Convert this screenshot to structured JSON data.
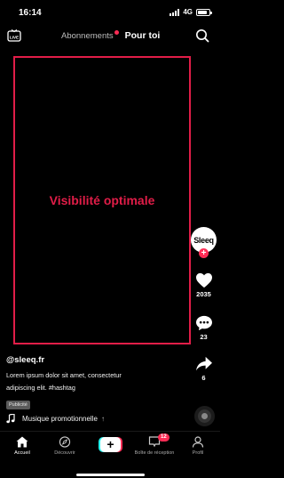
{
  "status_bar": {
    "time": "16:14",
    "network": "4G",
    "battery_level": 0.8
  },
  "top_bar": {
    "live_label": "LIVE",
    "tab_following": "Abonnements",
    "tab_for_you": "Pour toi"
  },
  "overlay": {
    "safe_zone_label": "Visibilité optimale",
    "color": "#e11d48"
  },
  "side_actions": {
    "avatar_text": "Sleeq",
    "likes": "2035",
    "comments": "23",
    "shares": "6"
  },
  "post": {
    "username": "@sleeq.fr",
    "caption_line1": "Lorem ipsum dolor sit amet, consectetur",
    "caption_line2": "adipiscing elit. #hashtag",
    "ad_badge": "Publicité",
    "music": "Musique promotionnelle"
  },
  "bottom_nav": {
    "home": "Accueil",
    "discover": "Découvrir",
    "inbox": "Boîte de réception",
    "inbox_badge": "12",
    "profile": "Profil"
  },
  "colors": {
    "accent": "#fe2c55",
    "accent_secondary": "#25f4ee"
  }
}
